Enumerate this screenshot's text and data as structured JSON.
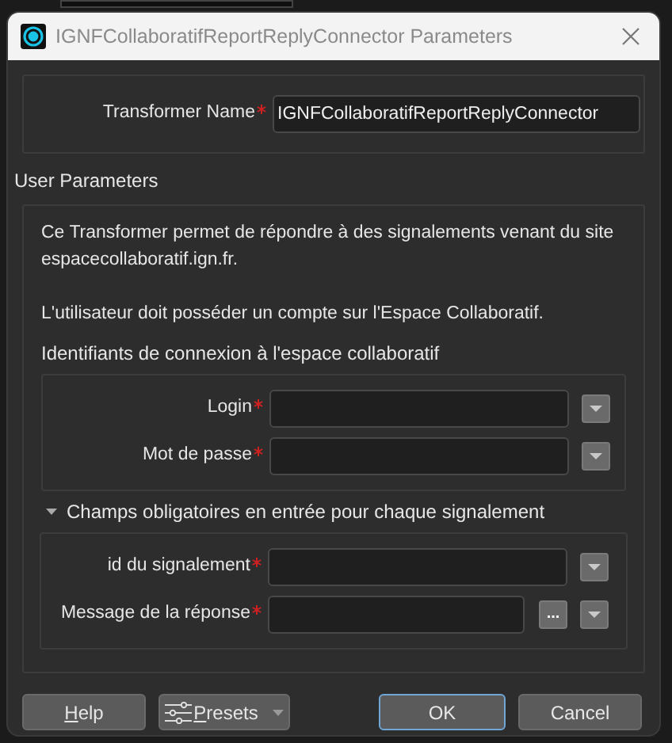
{
  "window": {
    "title": "IGNFCollaboratifReportReplyConnector Parameters"
  },
  "transformer_name": {
    "label": "Transformer Name",
    "required": true,
    "value": "IGNFCollaboratifReportReplyConnector"
  },
  "user_parameters": {
    "title": "User Parameters",
    "description": [
      "Ce Transformer permet de répondre à des signalements venant du site espacecollaboratif.ign.fr.",
      "L'utilisateur doit posséder un compte sur l'Espace Collaboratif."
    ],
    "groups": [
      {
        "kind": "plain",
        "title": "Identifiants de connexion à l'espace collaboratif",
        "fields": [
          {
            "label": "Login",
            "required": true
          },
          {
            "label": "Mot de passe",
            "required": true
          }
        ]
      },
      {
        "kind": "collapsible",
        "expanded": true,
        "title": "Champs obligatoires en entrée pour chaque signalement",
        "fields": [
          {
            "label": "id du signalement",
            "required": true
          },
          {
            "label": "Message de la réponse",
            "required": true,
            "browse_label": "..."
          }
        ]
      }
    ]
  },
  "buttons": [
    {
      "kind": "help",
      "label": "Help"
    },
    {
      "kind": "menu",
      "label": "Presets"
    },
    {
      "kind": "default",
      "label": "OK"
    },
    {
      "kind": "plain",
      "label": "Cancel"
    }
  ]
}
